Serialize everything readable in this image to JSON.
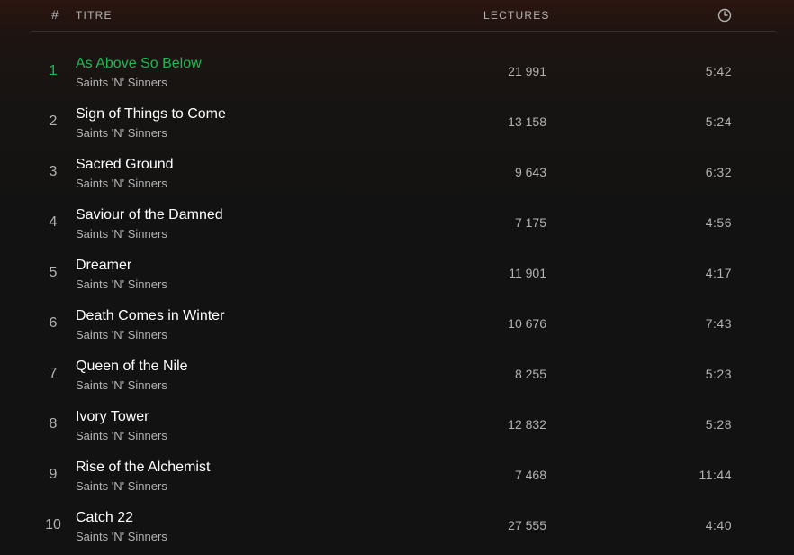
{
  "header": {
    "num_label": "#",
    "title_label": "TITRE",
    "plays_label": "LECTURES",
    "duration_icon": "clock-icon"
  },
  "colors": {
    "accent": "#1db954",
    "text_primary": "#ffffff",
    "text_secondary": "#b3b3b3",
    "background": "#121212"
  },
  "tracks": [
    {
      "num": "1",
      "title": "As Above So Below",
      "artist": "Saints 'N' Sinners",
      "plays": "21 991",
      "duration": "5:42",
      "playing": true
    },
    {
      "num": "2",
      "title": "Sign of Things to Come",
      "artist": "Saints 'N' Sinners",
      "plays": "13 158",
      "duration": "5:24",
      "playing": false
    },
    {
      "num": "3",
      "title": "Sacred Ground",
      "artist": "Saints 'N' Sinners",
      "plays": "9 643",
      "duration": "6:32",
      "playing": false
    },
    {
      "num": "4",
      "title": "Saviour of the Damned",
      "artist": "Saints 'N' Sinners",
      "plays": "7 175",
      "duration": "4:56",
      "playing": false
    },
    {
      "num": "5",
      "title": "Dreamer",
      "artist": "Saints 'N' Sinners",
      "plays": "11 901",
      "duration": "4:17",
      "playing": false
    },
    {
      "num": "6",
      "title": "Death Comes in Winter",
      "artist": "Saints 'N' Sinners",
      "plays": "10 676",
      "duration": "7:43",
      "playing": false
    },
    {
      "num": "7",
      "title": "Queen of the Nile",
      "artist": "Saints 'N' Sinners",
      "plays": "8 255",
      "duration": "5:23",
      "playing": false
    },
    {
      "num": "8",
      "title": "Ivory Tower",
      "artist": "Saints 'N' Sinners",
      "plays": "12 832",
      "duration": "5:28",
      "playing": false
    },
    {
      "num": "9",
      "title": "Rise of the Alchemist",
      "artist": "Saints 'N' Sinners",
      "plays": "7 468",
      "duration": "11:44",
      "playing": false
    },
    {
      "num": "10",
      "title": "Catch 22",
      "artist": "Saints 'N' Sinners",
      "plays": "27 555",
      "duration": "4:40",
      "playing": false
    }
  ]
}
